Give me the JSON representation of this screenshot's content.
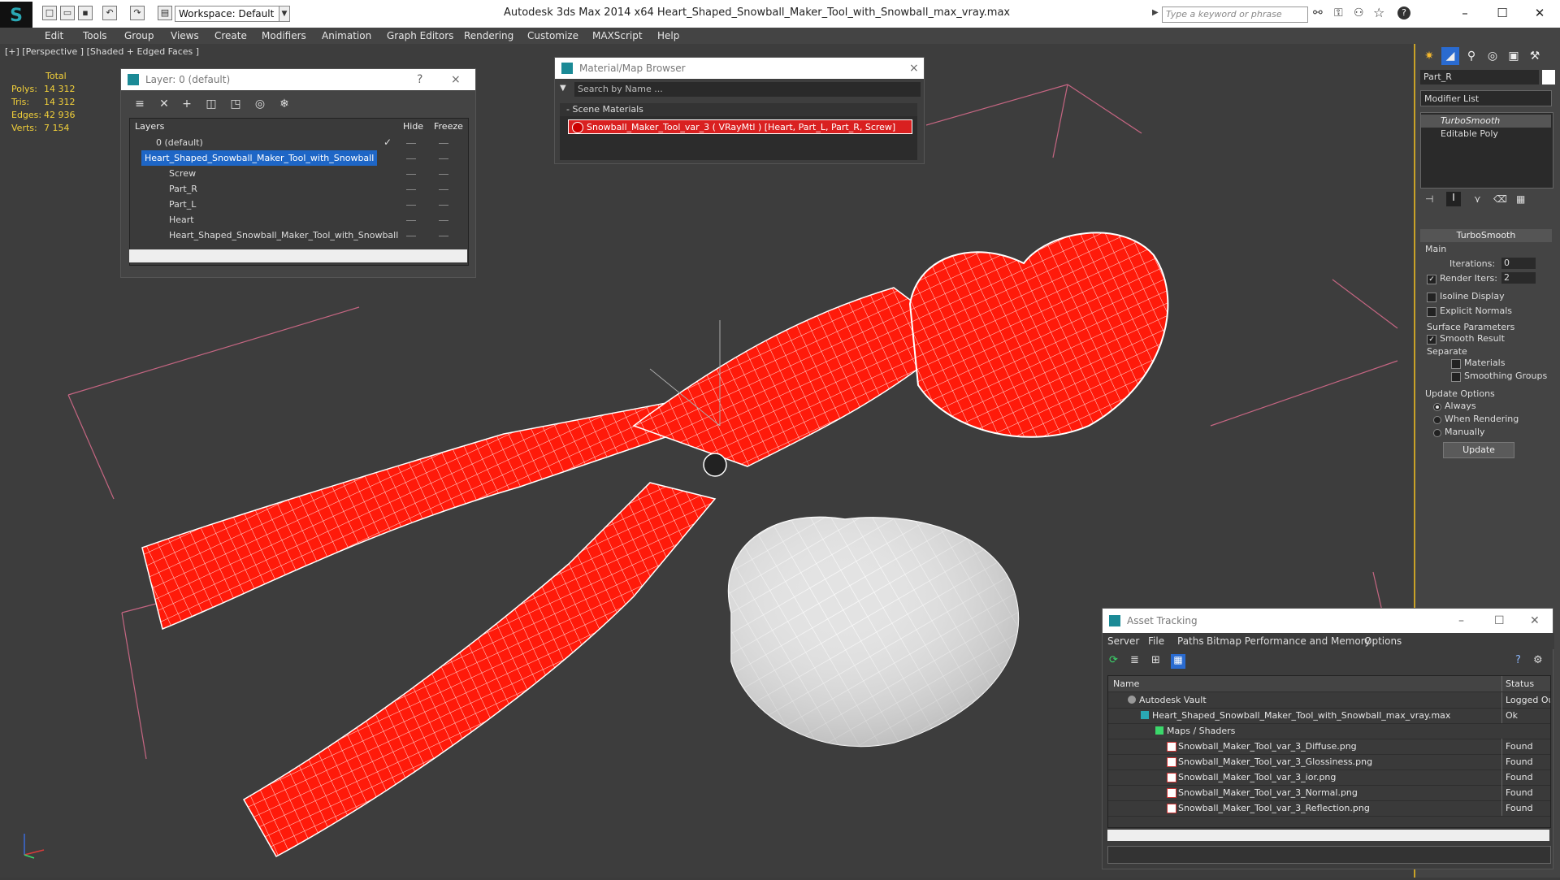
{
  "app": {
    "title": "Autodesk 3ds Max  2014 x64     Heart_Shaped_Snowball_Maker_Tool_with_Snowball_max_vray.max",
    "logo_text": "S",
    "workspace": "Workspace: Default",
    "search_placeholder": "Type a keyword or phrase",
    "accent": "#2aa7b3"
  },
  "menubar": [
    "Edit",
    "Tools",
    "Group",
    "Views",
    "Create",
    "Modifiers",
    "Animation",
    "Graph Editors",
    "Rendering",
    "Customize",
    "MAXScript",
    "Help"
  ],
  "viewport": {
    "label": "[+] [Perspective ] [Shaded + Edged Faces ]",
    "stats": {
      "header": "Total",
      "rows": [
        {
          "label": "Polys:",
          "value": "14 312"
        },
        {
          "label": "Tris:",
          "value": "14 312"
        },
        {
          "label": "Edges:",
          "value": "42 936"
        },
        {
          "label": "Verts:",
          "value": "7 154"
        }
      ]
    },
    "axis": {
      "x": "x",
      "y": "y",
      "z": "z"
    }
  },
  "layer_panel": {
    "title": "Layer: 0 (default)",
    "help": "?",
    "close": "×",
    "columns": {
      "layers": "Layers",
      "hide": "Hide",
      "freeze": "Freeze"
    },
    "rows": [
      {
        "name": "0 (default)",
        "indent": 0
      },
      {
        "name": "Heart_Shaped_Snowball_Maker_Tool_with_Snowball",
        "indent": 0,
        "selected": true
      },
      {
        "name": "Screw",
        "indent": 1
      },
      {
        "name": "Part_R",
        "indent": 1
      },
      {
        "name": "Part_L",
        "indent": 1
      },
      {
        "name": "Heart",
        "indent": 1
      },
      {
        "name": "Heart_Shaped_Snowball_Maker_Tool_with_Snowball",
        "indent": 1
      }
    ]
  },
  "material_browser": {
    "title": "Material/Map Browser",
    "search": "Search by Name ...",
    "group": "- Scene Materials",
    "item": "Snowball_Maker_Tool_var_3  ( VRayMtl )  [Heart, Part_L, Part_R, Screw]",
    "close": "×"
  },
  "command_panel": {
    "object_name": "Part_R",
    "modifier_list": "Modifier List",
    "stack": [
      "TurboSmooth",
      "Editable Poly"
    ],
    "rollout": "TurboSmooth",
    "main": "Main",
    "iterations_label": "Iterations:",
    "iterations": "0",
    "render_iters_label": "Render Iters:",
    "render_iters": "2",
    "isoline": "Isoline Display",
    "explicit": "Explicit Normals",
    "surface": "Surface Parameters",
    "smooth_result": "Smooth Result",
    "separate": "Separate",
    "materials": "Materials",
    "smoothing_groups": "Smoothing Groups",
    "update_options": "Update Options",
    "always": "Always",
    "when_rendering": "When Rendering",
    "manually": "Manually",
    "update_btn": "Update"
  },
  "asset_tracking": {
    "title": "Asset Tracking",
    "menu": [
      "Server",
      "File",
      "Paths",
      "Bitmap Performance and Memory",
      "Options"
    ],
    "columns": {
      "name": "Name",
      "status": "Status"
    },
    "rows": [
      {
        "name": "Autodesk Vault",
        "status": "Logged Out",
        "indent": 0
      },
      {
        "name": "Heart_Shaped_Snowball_Maker_Tool_with_Snowball_max_vray.max",
        "status": "Ok",
        "indent": 1
      },
      {
        "name": "Maps / Shaders",
        "status": "",
        "indent": 2
      },
      {
        "name": "Snowball_Maker_Tool_var_3_Diffuse.png",
        "status": "Found",
        "indent": 3
      },
      {
        "name": "Snowball_Maker_Tool_var_3_Glossiness.png",
        "status": "Found",
        "indent": 3
      },
      {
        "name": "Snowball_Maker_Tool_var_3_ior.png",
        "status": "Found",
        "indent": 3
      },
      {
        "name": "Snowball_Maker_Tool_var_3_Normal.png",
        "status": "Found",
        "indent": 3
      },
      {
        "name": "Snowball_Maker_Tool_var_3_Reflection.png",
        "status": "Found",
        "indent": 3
      }
    ]
  },
  "colors": {
    "model": "#ff1a0a",
    "snowball": "#e8e8e8",
    "highlight": "#1e66c6",
    "stats": "#f2d03a"
  }
}
